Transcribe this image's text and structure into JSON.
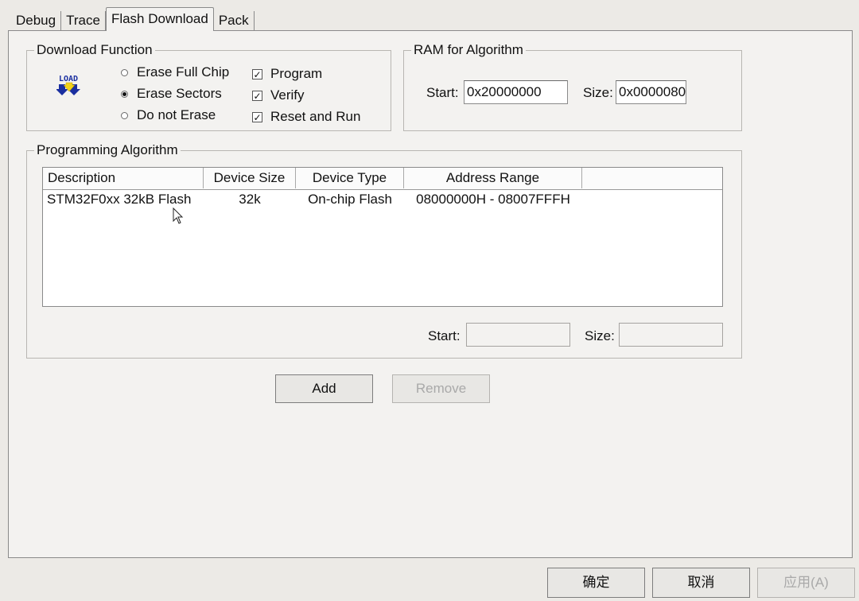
{
  "tabs": [
    {
      "label": "Debug"
    },
    {
      "label": "Trace"
    },
    {
      "label": "Flash Download",
      "active": true
    },
    {
      "label": "Pack"
    }
  ],
  "download_function": {
    "title": "Download Function",
    "icon": "load-icon",
    "icon_text": "LOAD",
    "erase_options": [
      {
        "label": "Erase Full Chip",
        "selected": false
      },
      {
        "label": "Erase Sectors",
        "selected": true
      },
      {
        "label": "Do not Erase",
        "selected": false
      }
    ],
    "checkboxes": [
      {
        "label": "Program",
        "checked": true
      },
      {
        "label": "Verify",
        "checked": true
      },
      {
        "label": "Reset and Run",
        "checked": true
      }
    ]
  },
  "ram_algorithm": {
    "title": "RAM for Algorithm",
    "start_label": "Start:",
    "start_value": "0x20000000",
    "size_label": "Size:",
    "size_value": "0x0000080"
  },
  "programming_algorithm": {
    "title": "Programming Algorithm",
    "columns": [
      "Description",
      "Device Size",
      "Device Type",
      "Address Range"
    ],
    "rows": [
      {
        "description": "STM32F0xx 32kB Flash",
        "device_size": "32k",
        "device_type": "On-chip Flash",
        "address_range": "08000000H - 08007FFFH"
      }
    ],
    "start_label": "Start:",
    "start_value": "",
    "size_label": "Size:",
    "size_value": ""
  },
  "buttons": {
    "add": "Add",
    "remove": "Remove",
    "ok": "确定",
    "cancel": "取消",
    "apply": "应用(A)"
  },
  "colors": {
    "panel_bg": "#f3f2f0",
    "window_bg": "#eceae6",
    "load_icon_blue": "#1a2fa0",
    "load_icon_yellow": "#f2d21a"
  }
}
